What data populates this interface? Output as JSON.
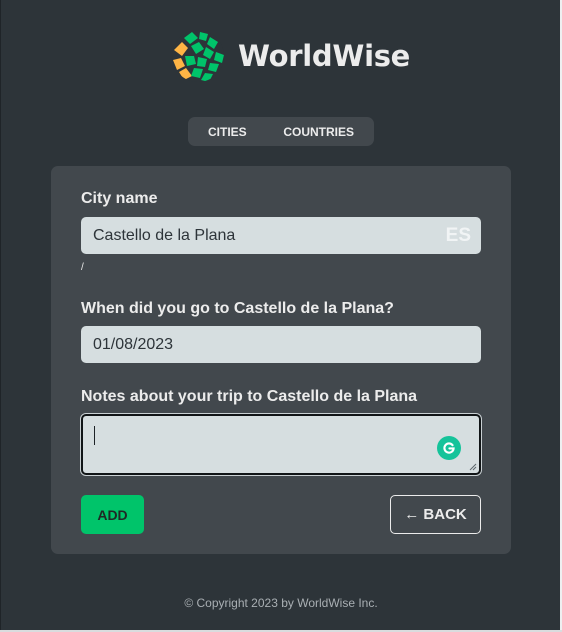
{
  "app": {
    "name": "WorldWise",
    "logo_icon": "globe-logo-icon"
  },
  "nav": {
    "items": [
      {
        "label": "Cities"
      },
      {
        "label": "Countries"
      }
    ]
  },
  "form": {
    "city_label": "City name",
    "city_value": "Castello de la Plana",
    "country_code": "ES",
    "mark": "/",
    "date_label": "When did you go to Castello de la Plana?",
    "date_value": "01/08/2023",
    "notes_label": "Notes about your trip to Castello de la Plana",
    "notes_value": "",
    "add_label": "ADD",
    "back_label": "← BACK"
  },
  "footer": {
    "copyright": "© Copyright 2023 by WorldWise Inc."
  },
  "colors": {
    "background": "#2d3439",
    "card": "#42484d",
    "input": "#d6dee0",
    "brand_green": "#00c46a",
    "brand_orange": "#ffb545",
    "grammarly": "#15c39a"
  }
}
